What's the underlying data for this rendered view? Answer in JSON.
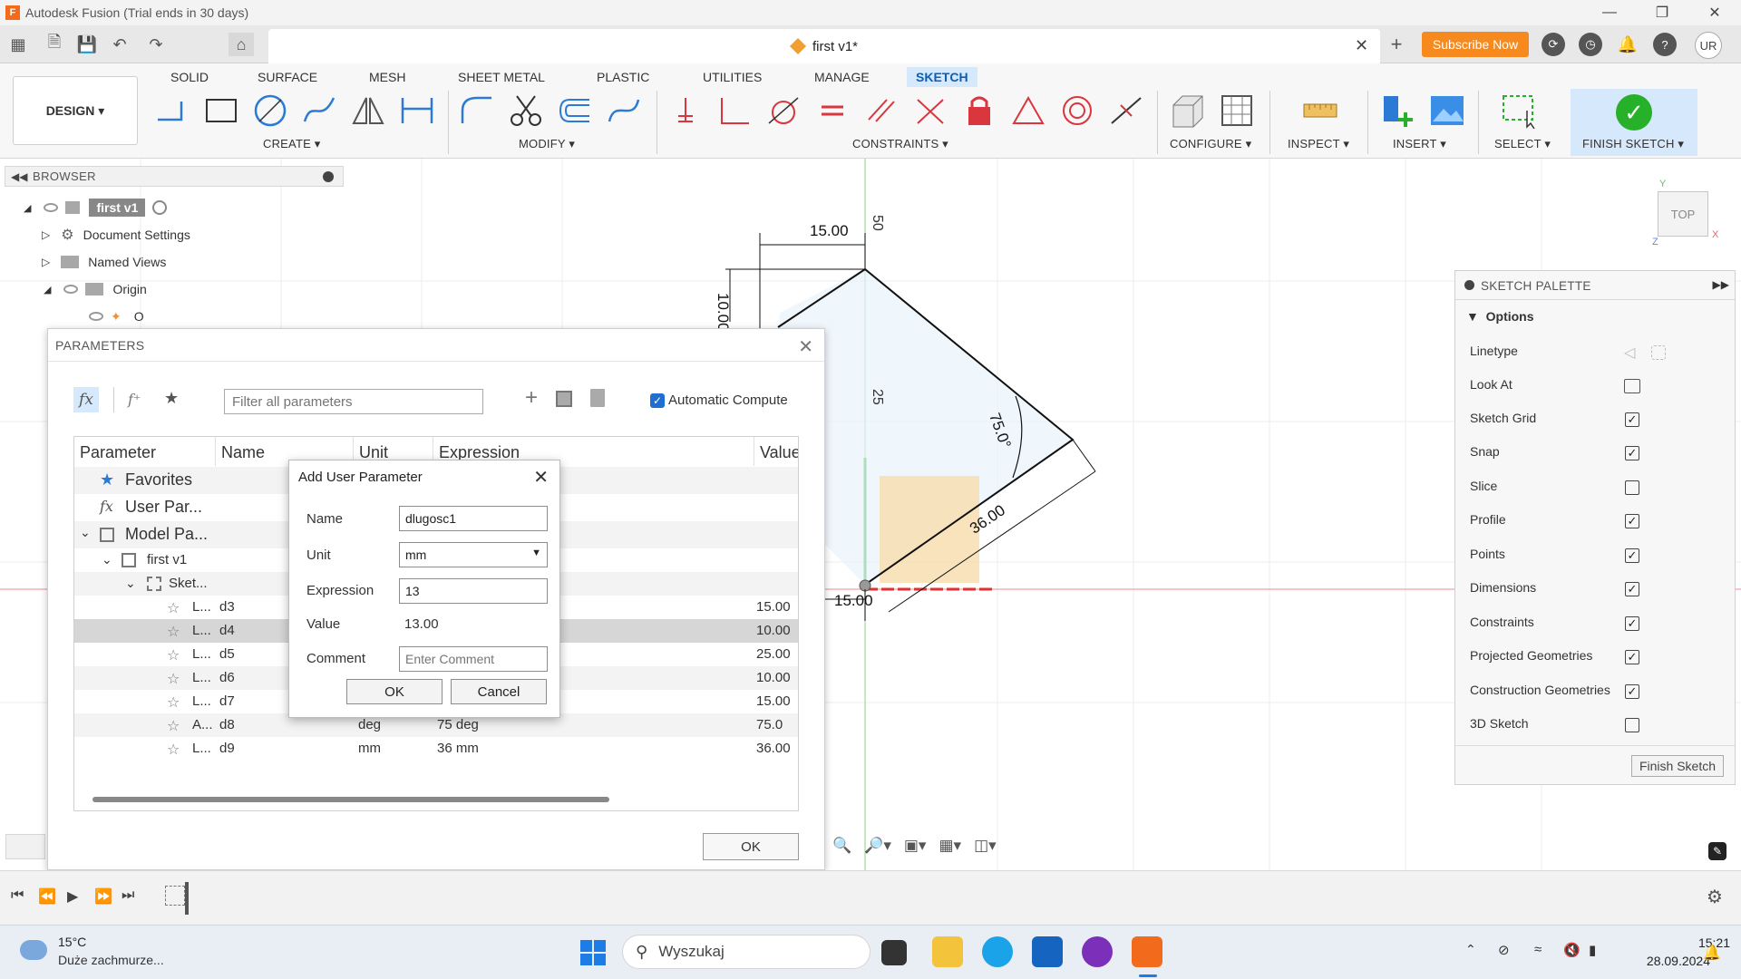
{
  "window": {
    "title": "Autodesk Fusion (Trial ends in 30 days)",
    "document_tab": "first v1*",
    "subscribe": "Subscribe Now",
    "user_initials": "UR"
  },
  "toolbar": {
    "workspace": "DESIGN",
    "tabs": [
      "SOLID",
      "SURFACE",
      "MESH",
      "SHEET METAL",
      "PLASTIC",
      "UTILITIES",
      "MANAGE",
      "SKETCH"
    ],
    "active_tab": "SKETCH",
    "groups": {
      "create": "CREATE",
      "modify": "MODIFY",
      "constraints": "CONSTRAINTS",
      "configure": "CONFIGURE",
      "inspect": "INSPECT",
      "insert": "INSERT",
      "select": "SELECT",
      "finish_sketch": "FINISH SKETCH"
    }
  },
  "browser": {
    "title": "BROWSER",
    "root": "first v1",
    "items": [
      "Document Settings",
      "Named Views",
      "Origin",
      "O"
    ]
  },
  "sketch": {
    "dim_top": "15.00",
    "dim_left": "10.00",
    "dim_vertical_top": "50",
    "dim_vertical_mid": "25",
    "angle": "75.0°",
    "dim_diag": "36.00",
    "dim_bottom": "15.00"
  },
  "viewcube": {
    "face": "TOP",
    "axis_y": "Y",
    "axis_x": "X",
    "axis_z": "Z"
  },
  "parameters": {
    "title": "PARAMETERS",
    "filter_placeholder": "Filter all parameters",
    "auto_compute": "Automatic Compute",
    "columns": [
      "Parameter",
      "Name",
      "Unit",
      "Expression",
      "Value"
    ],
    "groups": [
      "Favorites",
      "User Par...",
      "Model Pa..."
    ],
    "component": "first v1",
    "sketch": "Sket...",
    "rows": [
      {
        "param": "L...",
        "name": "d3",
        "unit": "",
        "expr": "",
        "value": "15.00"
      },
      {
        "param": "L...",
        "name": "d4",
        "unit": "",
        "expr": "",
        "value": "10.00"
      },
      {
        "param": "L...",
        "name": "d5",
        "unit": "",
        "expr": "",
        "value": "25.00"
      },
      {
        "param": "L...",
        "name": "d6",
        "unit": "",
        "expr": "",
        "value": "10.00"
      },
      {
        "param": "L...",
        "name": "d7",
        "unit": "",
        "expr": "",
        "value": "15.00"
      },
      {
        "param": "A...",
        "name": "d8",
        "unit": "deg",
        "expr": "75 deg",
        "value": "75.0"
      },
      {
        "param": "L...",
        "name": "d9",
        "unit": "mm",
        "expr": "36 mm",
        "value": "36.00"
      }
    ],
    "ok": "OK"
  },
  "add_user_parameter": {
    "title": "Add User Parameter",
    "name_label": "Name",
    "name_value": "dlugosc1",
    "unit_label": "Unit",
    "unit_value": "mm",
    "expression_label": "Expression",
    "expression_value": "13",
    "value_label": "Value",
    "value_value": "13.00",
    "comment_label": "Comment",
    "comment_placeholder": "Enter Comment",
    "ok": "OK",
    "cancel": "Cancel"
  },
  "palette": {
    "title": "SKETCH PALETTE",
    "section": "Options",
    "options": [
      {
        "label": "Linetype",
        "checked": null
      },
      {
        "label": "Look At",
        "checked": null
      },
      {
        "label": "Sketch Grid",
        "checked": true
      },
      {
        "label": "Snap",
        "checked": true
      },
      {
        "label": "Slice",
        "checked": false
      },
      {
        "label": "Profile",
        "checked": true
      },
      {
        "label": "Points",
        "checked": true
      },
      {
        "label": "Dimensions",
        "checked": true
      },
      {
        "label": "Constraints",
        "checked": true
      },
      {
        "label": "Projected Geometries",
        "checked": true
      },
      {
        "label": "Construction Geometries",
        "checked": true
      },
      {
        "label": "3D Sketch",
        "checked": false
      }
    ],
    "finish": "Finish Sketch"
  },
  "taskbar": {
    "temperature": "15°C",
    "weather": "Duże zachmurze...",
    "search": "Wyszukaj",
    "time": "15:21",
    "date": "28.09.2024"
  }
}
